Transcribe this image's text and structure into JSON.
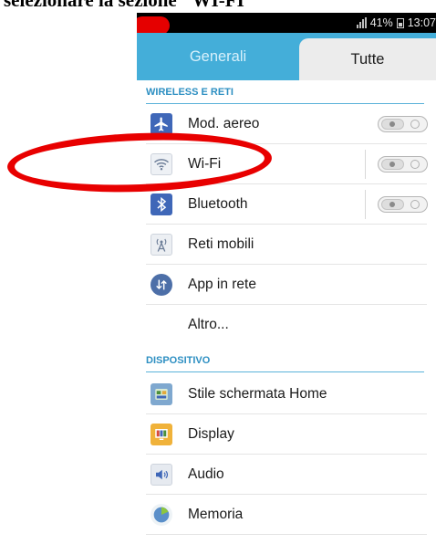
{
  "caption": "selezionare la sezione \"WI-FI\"",
  "status_bar": {
    "battery": "41%",
    "time": "13:07"
  },
  "tabs": {
    "general": "Generali",
    "all": "Tutte"
  },
  "sections": {
    "wireless": "WIRELESS E RETI",
    "device": "DISPOSITIVO"
  },
  "items": {
    "airplane": "Mod. aereo",
    "wifi": "Wi-Fi",
    "bluetooth": "Bluetooth",
    "mobile": "Reti mobili",
    "apps_network": "App in rete",
    "more": "Altro...",
    "home_style": "Stile schermata Home",
    "display": "Display",
    "audio": "Audio",
    "storage": "Memoria"
  },
  "colors": {
    "tab_bar": "#44aed9",
    "section_text": "#2d8fc2",
    "annotation_red": "#e80000",
    "icon_blue": "#3f67b8"
  }
}
